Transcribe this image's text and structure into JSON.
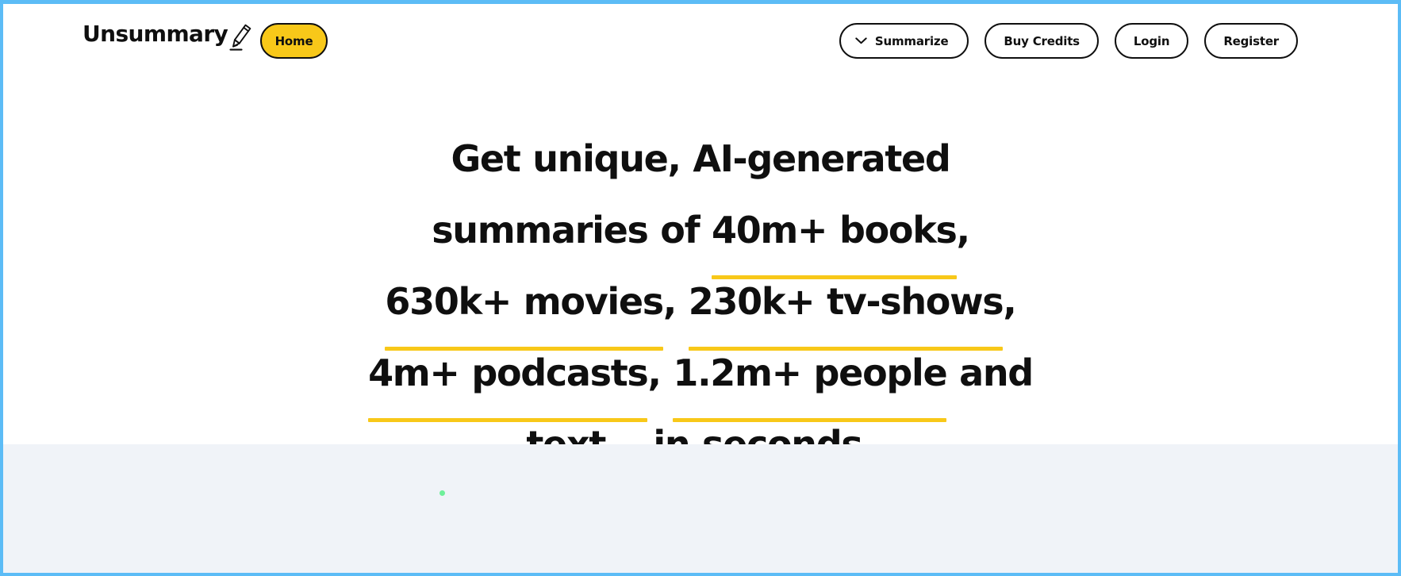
{
  "window": {
    "accent_border_color": "#5cbcf6",
    "background_color": "#ffffff"
  },
  "header": {
    "brand_name": "Unsummary",
    "brand_icon": "pencil-icon",
    "home_label": "Home",
    "home_bg_color": "#f8c819",
    "nav": [
      {
        "label": "Summarize",
        "icon": "chevron-down-icon"
      },
      {
        "label": "Buy Credits",
        "icon": null
      },
      {
        "label": "Login",
        "icon": null
      },
      {
        "label": "Register",
        "icon": null
      }
    ]
  },
  "hero": {
    "line1_prefix": "Get unique, AI-generated summaries of ",
    "stat_books": "40m+ books",
    "sep1": ", ",
    "stat_movies": "630k+ movies",
    "sep2": ", ",
    "stat_tvshows": "230k+ tv-shows",
    "sep3": ", ",
    "stat_podcasts": "4m+ podcasts",
    "sep4": ", ",
    "stat_people": "1.2m+ people",
    "sep5": " and ",
    "stat_text": "text",
    "line_suffix": "… in seconds.",
    "underline_color": "#f8c819"
  },
  "lower": {
    "background_color": "#f0f3f8",
    "loading_indicator_color": "#6ef09a"
  }
}
